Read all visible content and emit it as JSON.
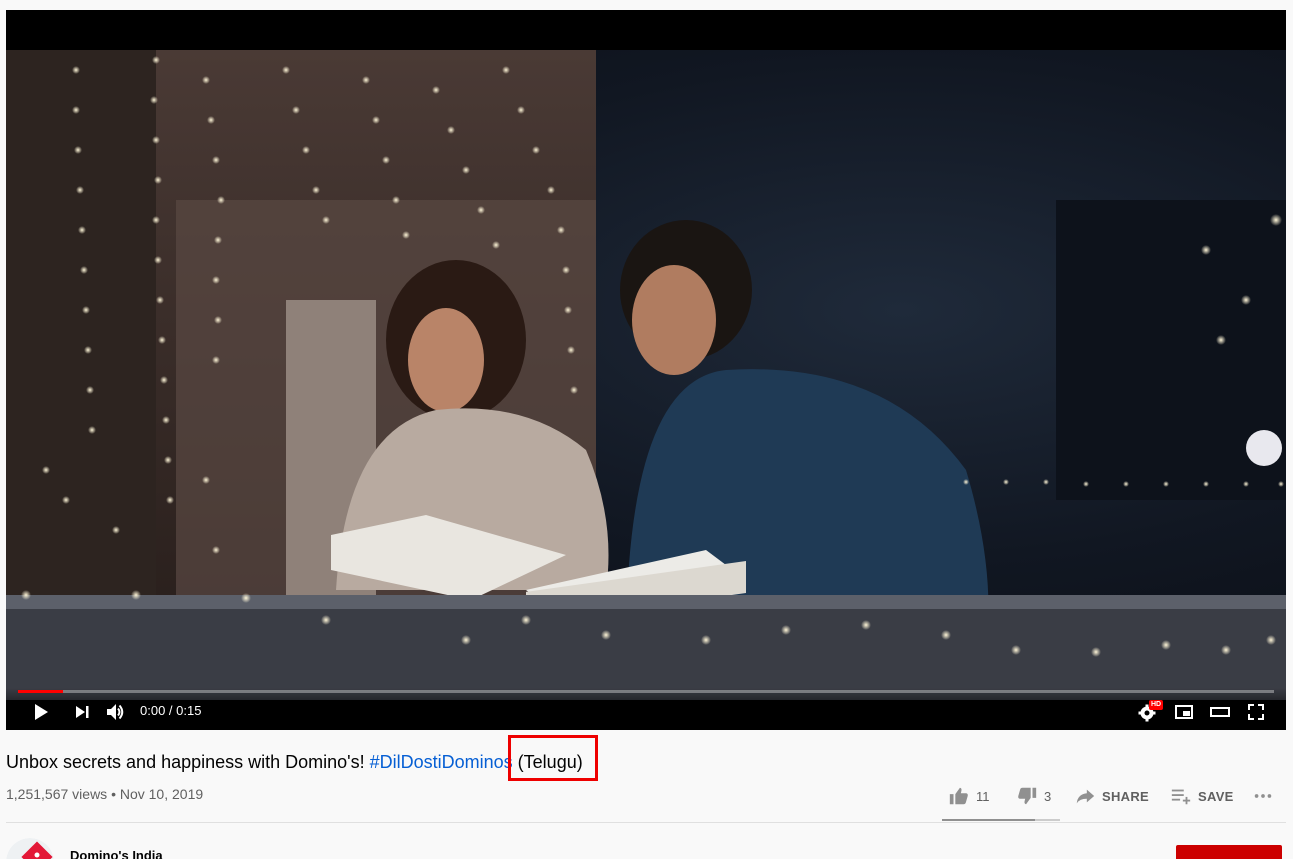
{
  "player": {
    "time": "0:00 / 0:15",
    "progress": 0.036,
    "quality_badge": "HD"
  },
  "video": {
    "title_prefix": "Unbox secrets and happiness with Domino's! ",
    "hashtag": "#DilDostiDominos",
    "title_suffix": " (Telugu)",
    "views_date": "1,251,567 views • Nov 10, 2019"
  },
  "actions": {
    "like_count": "11",
    "dislike_count": "3",
    "share_label": "SHARE",
    "save_label": "SAVE",
    "like_ratio": 0.79
  },
  "channel": {
    "name": "Domino's India"
  },
  "colors": {
    "accent": "#065fd4",
    "progress": "#ff0000",
    "subscribe": "#cc0000",
    "highlight": "#ee0000"
  }
}
